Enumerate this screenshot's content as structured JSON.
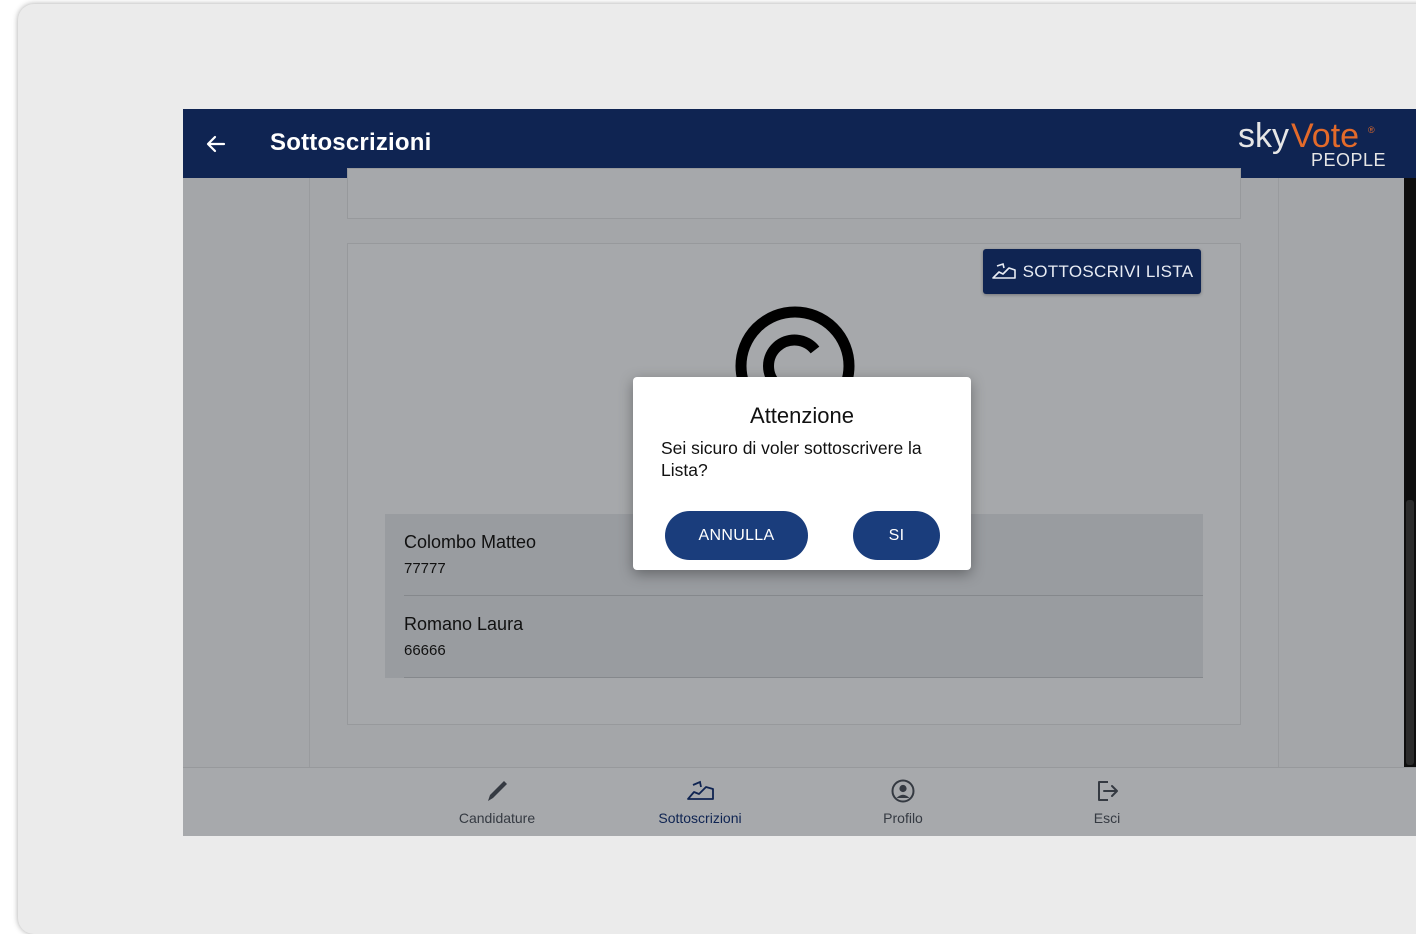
{
  "header": {
    "title": "Sottoscrizioni",
    "logo_sky": "sky",
    "logo_vote": "Vote",
    "logo_reg": "®",
    "logo_people": "PEOPLE"
  },
  "card": {
    "sign_button_label": "SOTTOSCRIVI LISTA"
  },
  "candidates": [
    {
      "name": "Colombo Matteo",
      "code": "77777"
    },
    {
      "name": "Romano Laura",
      "code": "66666"
    }
  ],
  "bottom_nav": {
    "items": [
      {
        "label": "Candidature",
        "icon": "pencil-icon"
      },
      {
        "label": "Sottoscrizioni",
        "icon": "sign-hand-icon",
        "active": true
      },
      {
        "label": "Profilo",
        "icon": "user-circle-icon"
      },
      {
        "label": "Esci",
        "icon": "logout-icon"
      }
    ]
  },
  "dialog": {
    "title": "Attenzione",
    "message": "Sei sicuro di voler sottoscrivere la Lista?",
    "cancel_label": "ANNULLA",
    "confirm_label": "SI"
  },
  "colors": {
    "header_bg": "#0f2452",
    "brand_orange": "#e36a2a",
    "button_blue": "#1a3d7c"
  }
}
